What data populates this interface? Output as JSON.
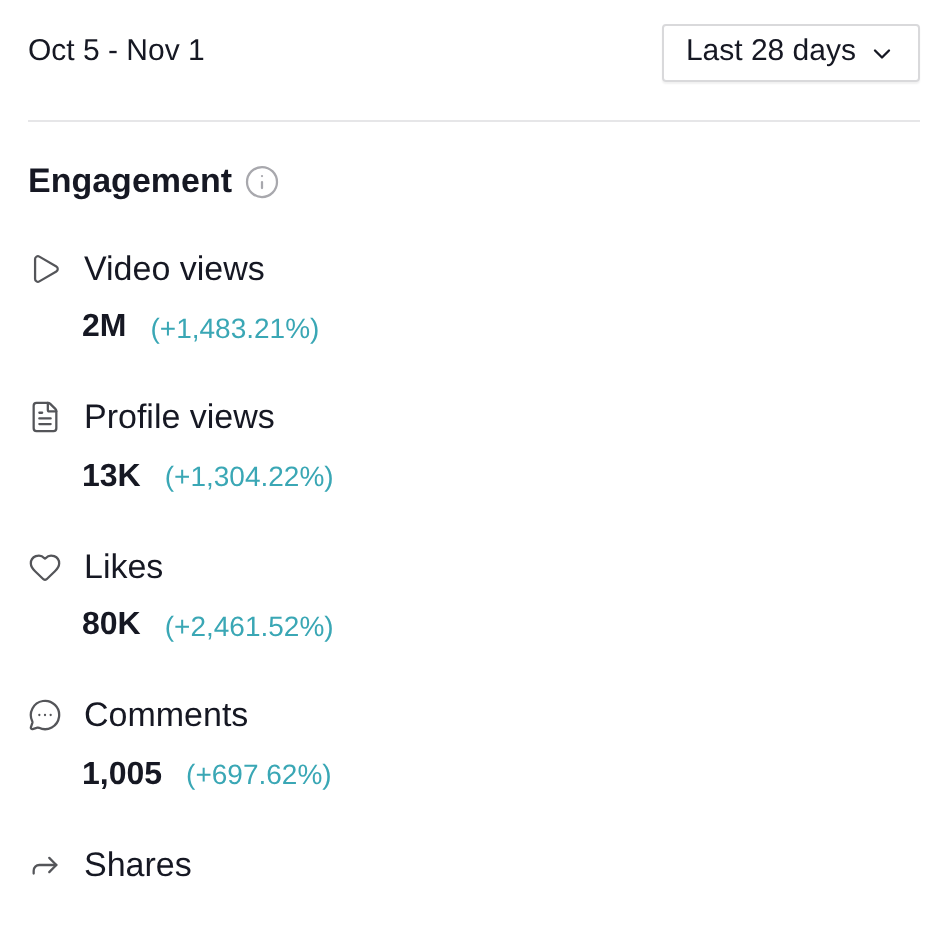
{
  "date_range": "Oct 5 - Nov 1",
  "period_dropdown": {
    "label": "Last 28 days"
  },
  "section": {
    "title": "Engagement"
  },
  "metrics": [
    {
      "kind": "video",
      "label": "Video views",
      "value": "2M",
      "change": "(+1,483.21%)"
    },
    {
      "kind": "profile",
      "label": "Profile views",
      "value": "13K",
      "change": "(+1,304.22%)"
    },
    {
      "kind": "likes",
      "label": "Likes",
      "value": "80K",
      "change": "(+2,461.52%)"
    },
    {
      "kind": "comments",
      "label": "Comments",
      "value": "1,005",
      "change": "(+697.62%)"
    },
    {
      "kind": "shares",
      "label": "Shares"
    }
  ]
}
